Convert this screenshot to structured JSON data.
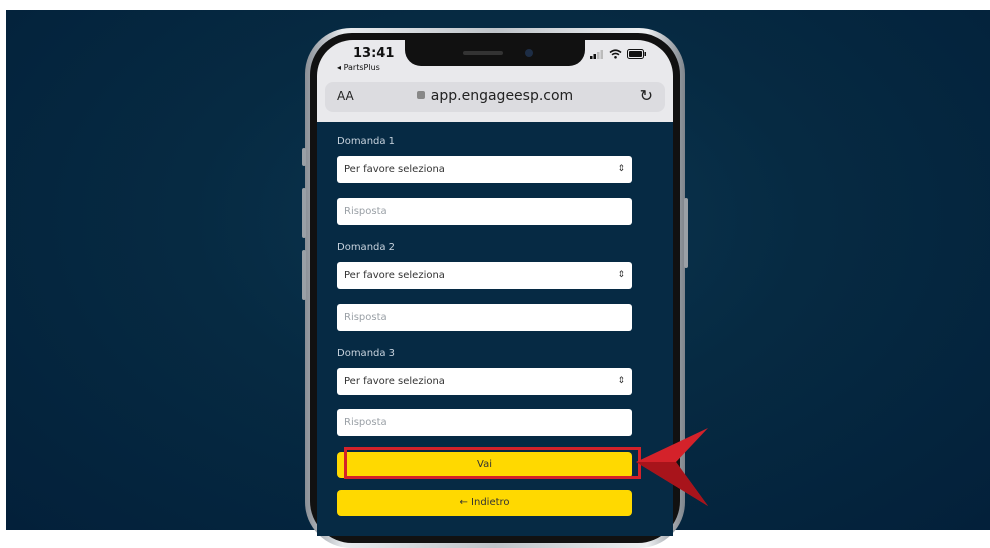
{
  "status_bar": {
    "time": "13:41",
    "back_app": "PartsPlus"
  },
  "browser": {
    "text_size_label": "AA",
    "url": "app.engageesp.com"
  },
  "form": {
    "questions": [
      {
        "label": "Domanda 1",
        "select_value": "Per favore seleziona",
        "answer_placeholder": "Risposta"
      },
      {
        "label": "Domanda 2",
        "select_value": "Per favore seleziona",
        "answer_placeholder": "Risposta"
      },
      {
        "label": "Domanda 3",
        "select_value": "Per favore seleziona",
        "answer_placeholder": "Risposta"
      }
    ],
    "submit_label": "Vai",
    "back_label": "← Indietro"
  },
  "colors": {
    "background": "#062a44",
    "button": "#ffd900",
    "highlight": "#d4222a"
  },
  "icons": [
    "signal-icon",
    "wifi-icon",
    "battery-icon",
    "lock-icon",
    "reload-icon",
    "chevron-updown-icon",
    "pointer-arrow-icon"
  ]
}
